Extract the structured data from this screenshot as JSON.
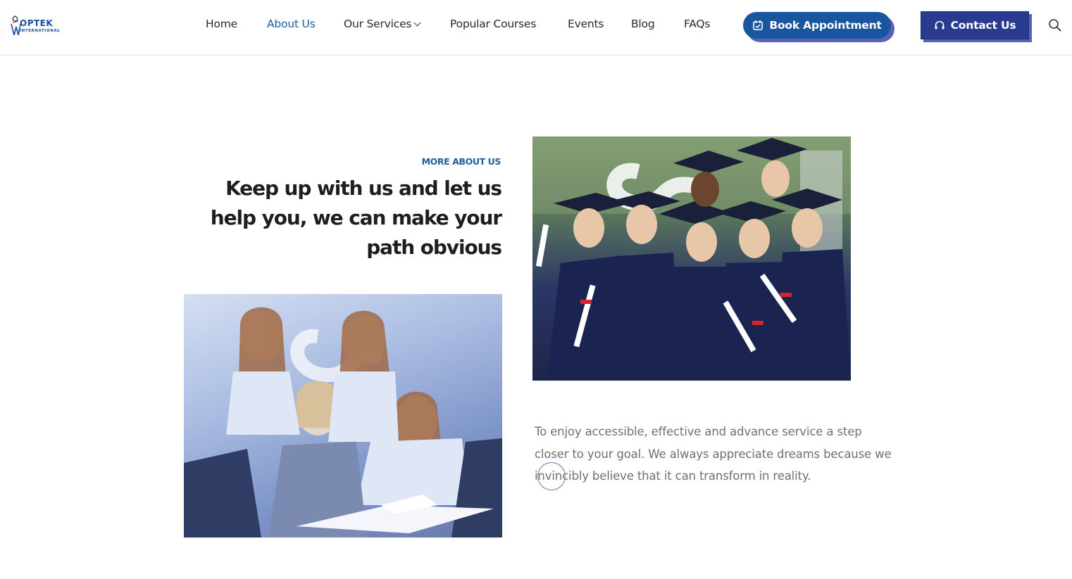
{
  "brand": {
    "name": "OPTEK",
    "tagline": "INTERNATIONAL"
  },
  "nav": {
    "items": [
      {
        "label": "Home"
      },
      {
        "label": "About Us"
      },
      {
        "label": "Our Services"
      },
      {
        "label": "Popular Courses"
      },
      {
        "label": "Events"
      },
      {
        "label": "Blog"
      },
      {
        "label": "FAQs"
      }
    ],
    "active": "About Us",
    "book_label": "Book Appointment",
    "contact_label": "Contact Us"
  },
  "about": {
    "eyebrow": "MORE ABOUT US",
    "headline": "Keep up with us and let us help you, we can make your path obvious",
    "body": "To enjoy accessible, effective and advance service a step closer to your goal. We always appreciate dreams because we invincibly believe that it can transform in reality."
  },
  "colors": {
    "accent": "#1f5fa0",
    "button_primary": "#1a56a0",
    "button_dark": "#2a3a8e",
    "shadow": "#5a62b8",
    "body_text": "#707070"
  }
}
